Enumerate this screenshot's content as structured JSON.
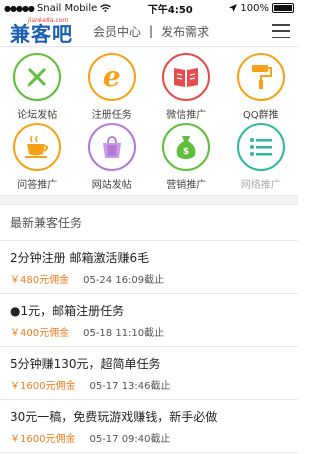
{
  "status_bar": {
    "carrier": "Snail Mobile",
    "time": "下午4:50",
    "battery": "100%"
  },
  "header": {
    "logo_small": "Jianke8a.com",
    "logo_main": "兼客吧",
    "nav": [
      {
        "label": "会员中心"
      },
      {
        "label": "发布需求"
      }
    ],
    "separator": "|"
  },
  "grid": [
    {
      "label": "论坛发帖",
      "icon": "pencil-ruler-icon",
      "color": "#5fbf3a"
    },
    {
      "label": "注册任务",
      "icon": "browser-e-icon",
      "color": "#f5a21a"
    },
    {
      "label": "微信推广",
      "icon": "book-icon",
      "color": "#e84b4b"
    },
    {
      "label": "QQ群推",
      "icon": "paint-roller-icon",
      "color": "#f5a21a"
    },
    {
      "label": "问答推广",
      "icon": "coffee-cup-icon",
      "color": "#f5a21a"
    },
    {
      "label": "网站发帖",
      "icon": "shopping-bag-icon",
      "color": "#b27ad6"
    },
    {
      "label": "营销推广",
      "icon": "money-bag-icon",
      "color": "#5fbf3a"
    },
    {
      "label": "网络推广",
      "icon": "list-icon",
      "color": "#2fb8a2"
    }
  ],
  "section_title": "最新兼客任务",
  "tasks": [
    {
      "title": "2分钟注册 邮箱激活赚6毛",
      "reward": "￥480元佣金",
      "deadline": "05-24 16:09截止"
    },
    {
      "title": "●1元，邮箱注册任务",
      "reward": "￥400元佣金",
      "deadline": "05-18 11:10截止"
    },
    {
      "title": "5分钟赚130元，超简单任务",
      "reward": "￥1600元佣金",
      "deadline": "05-17 13:46截止"
    },
    {
      "title": "30元一稿，免费玩游戏赚钱，新手必做",
      "reward": "￥1600元佣金",
      "deadline": "05-17 09:40截止"
    }
  ]
}
